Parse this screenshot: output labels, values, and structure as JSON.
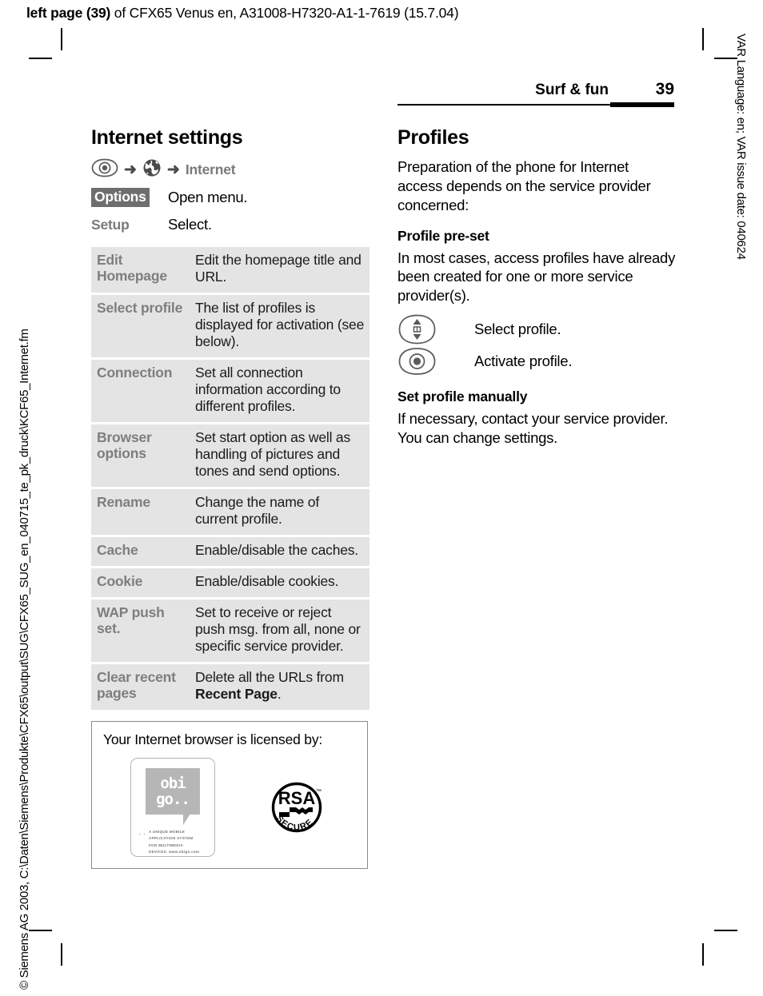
{
  "running_head": {
    "bold_part": "left page (39)",
    "rest": " of CFX65 Venus en, A31008-H7320-A1-1-7619 (15.7.04)"
  },
  "side_text": {
    "left": "© Siemens AG 2003, C:\\Daten\\Siemens\\Produkte\\CFX65\\output\\SUG\\CFX65_SUG_en_040715_te_pk_druck\\KCF65_Internet.fm",
    "right": "VAR Language: en; VAR issue date: 040624"
  },
  "page_header": {
    "chapter": "Surf & fun",
    "page_number": "39"
  },
  "left_column": {
    "title": "Internet settings",
    "nav": {
      "select_key_icon": "select-key-icon",
      "arrow1": "➜",
      "globe_icon": "globe-icon",
      "arrow2": "➜",
      "menu_label": "Internet"
    },
    "key_rows": [
      {
        "key_type": "softkey",
        "key_label": "Options",
        "text": "Open menu."
      },
      {
        "key_type": "menuword",
        "key_label": "Setup",
        "text": "Select."
      }
    ],
    "table": {
      "rows": [
        {
          "option": "Edit Homepage",
          "description": "Edit the homepage title and URL."
        },
        {
          "option": "Select profile",
          "description": "The list of profiles is displayed for activation (see below)."
        },
        {
          "option": "Connection",
          "description": "Set all connection information according to different profiles."
        },
        {
          "option": "Browser options",
          "description": "Set start option as well as handling of pictures and tones and send options."
        },
        {
          "option": "Rename",
          "description": "Change the name of current profile."
        },
        {
          "option": "Cache",
          "description": "Enable/disable the caches."
        },
        {
          "option": "Cookie",
          "description": "Enable/disable cookies."
        },
        {
          "option": "WAP push set.",
          "description": "Set to receive or reject push msg. from all, none or specific service provider."
        },
        {
          "option": "Clear recent pages",
          "description_pre": "Delete all the URLs from ",
          "description_bold": "Recent Page",
          "description_post": "."
        }
      ]
    },
    "license_box": {
      "title": "Your Internet browser is licensed by:",
      "obigo": {
        "word_top": "obi",
        "word_bottom": "go..",
        "dots": "▪ ▪",
        "tagline_line1": "A UNIQUE MOBILE",
        "tagline_line2": "APPLICATION SYSTEM",
        "tagline_line3": "FOR MULTIMEDIA",
        "tagline_line4": "DEVICES. www.obigo.com"
      },
      "rsa": {
        "main": "RSA",
        "tm": "™",
        "arc": "SECURE"
      }
    }
  },
  "right_column": {
    "title": "Profiles",
    "intro": "Preparation of the phone for Internet access depends on the service provider concerned:",
    "sub1_title": "Profile pre-set",
    "sub1_body": "In most cases, access profiles have already been created for one or more service provider(s).",
    "key_rows": [
      {
        "icon": "up-down-key-icon",
        "text": "Select profile."
      },
      {
        "icon": "select-key-icon",
        "text": "Activate profile."
      }
    ],
    "sub2_title": "Set profile manually",
    "sub2_body": "If necessary, contact your service provider. You can change settings."
  },
  "colors": {
    "table_bg": "#e4e4e4",
    "table_key_text": "#7e7e7e",
    "softkey_bg": "#6e6e6e",
    "icon_gray": "#5a5a5a",
    "obigo_gray": "#b6b6b6"
  }
}
